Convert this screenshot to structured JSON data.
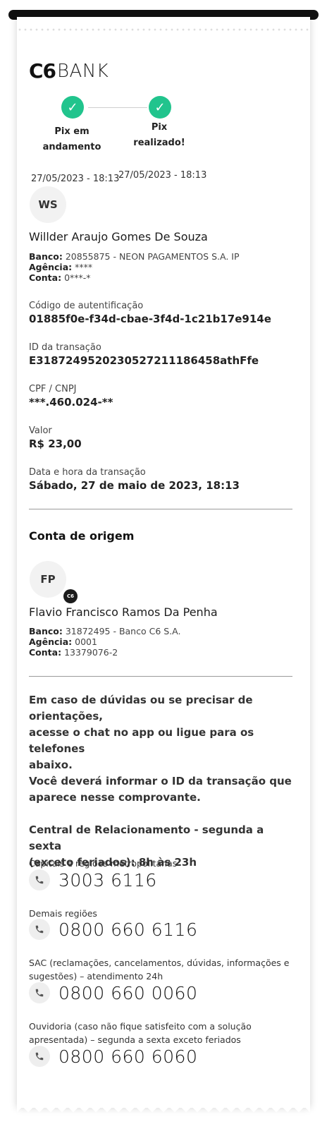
{
  "brand": {
    "logo_c6": "C6",
    "logo_bank": "BANK"
  },
  "steps": [
    {
      "label_line1": "Pix em",
      "label_line2": "andamento",
      "date": "27/05/2023 - 18:13",
      "icon": "check-icon"
    },
    {
      "label_line1": "Pix",
      "label_line2": "realizado!",
      "date": "27/05/2023 - 18:13",
      "icon": "check-icon"
    }
  ],
  "recipient": {
    "initials": "WS",
    "name": "Willder Araujo Gomes De Souza",
    "bank_label": "Banco:",
    "bank_value": "20855875 - NEON PAGAMENTOS S.A. IP",
    "agency_label": "Agência:",
    "agency_value": "****",
    "account_label": "Conta:",
    "account_value": "0***-*"
  },
  "transaction": {
    "auth_label": "Código de autentificação",
    "auth_value": "01885f0e-f34d-cbae-3f4d-1c21b17e914e",
    "id_label": "ID da transação",
    "id_value": "E31872495202305272111864 58athFfe",
    "cpf_label": "CPF / CNPJ",
    "cpf_value": "***.460.024-**",
    "amount_label": "Valor",
    "amount_value": "R$ 23,00",
    "datetime_label": "Data e hora da transação",
    "datetime_value": "Sábado, 27 de maio de 2023, 18:13"
  },
  "origin": {
    "title": "Conta de origem",
    "initials": "FP",
    "badge": "C6",
    "name": "Flavio Francisco Ramos Da Penha",
    "bank_label": "Banco:",
    "bank_value": "31872495 - Banco C6 S.A.",
    "agency_label": "Agência:",
    "agency_value": "0001",
    "account_label": "Conta:",
    "account_value": "13379076-2"
  },
  "info": {
    "p1_l1": "Em caso de dúvidas ou se precisar de orientações,",
    "p1_l2": "acesse o chat no app ou ligue para os telefones",
    "p1_l3": "abaixo.",
    "p2_l1": "Você deverá informar o ID da transação que",
    "p2_l2": "aparece nesse comprovante.",
    "p3_l1": "Central de Relacionamento - segunda a sexta",
    "p3_l2": "(exceto feriados): 8h às 23h"
  },
  "phones": [
    {
      "label": "Capitais e regiões metropolitanas",
      "number": "3003 6116"
    },
    {
      "label": "Demais regiões",
      "number": "0800 660 6116"
    },
    {
      "label": "SAC (reclamações, cancelamentos, dúvidas, informações e sugestões) – atendimento 24h",
      "number": "0800 660 0060"
    },
    {
      "label": "Ouvidoria (caso não fique satisfeito com a solução apresentada) – segunda a sexta exceto feriados",
      "number": "0800 660 6060"
    }
  ],
  "colors": {
    "success": "#21c48d",
    "text": "#1c1c1c",
    "divider": "#9a9a9a"
  }
}
